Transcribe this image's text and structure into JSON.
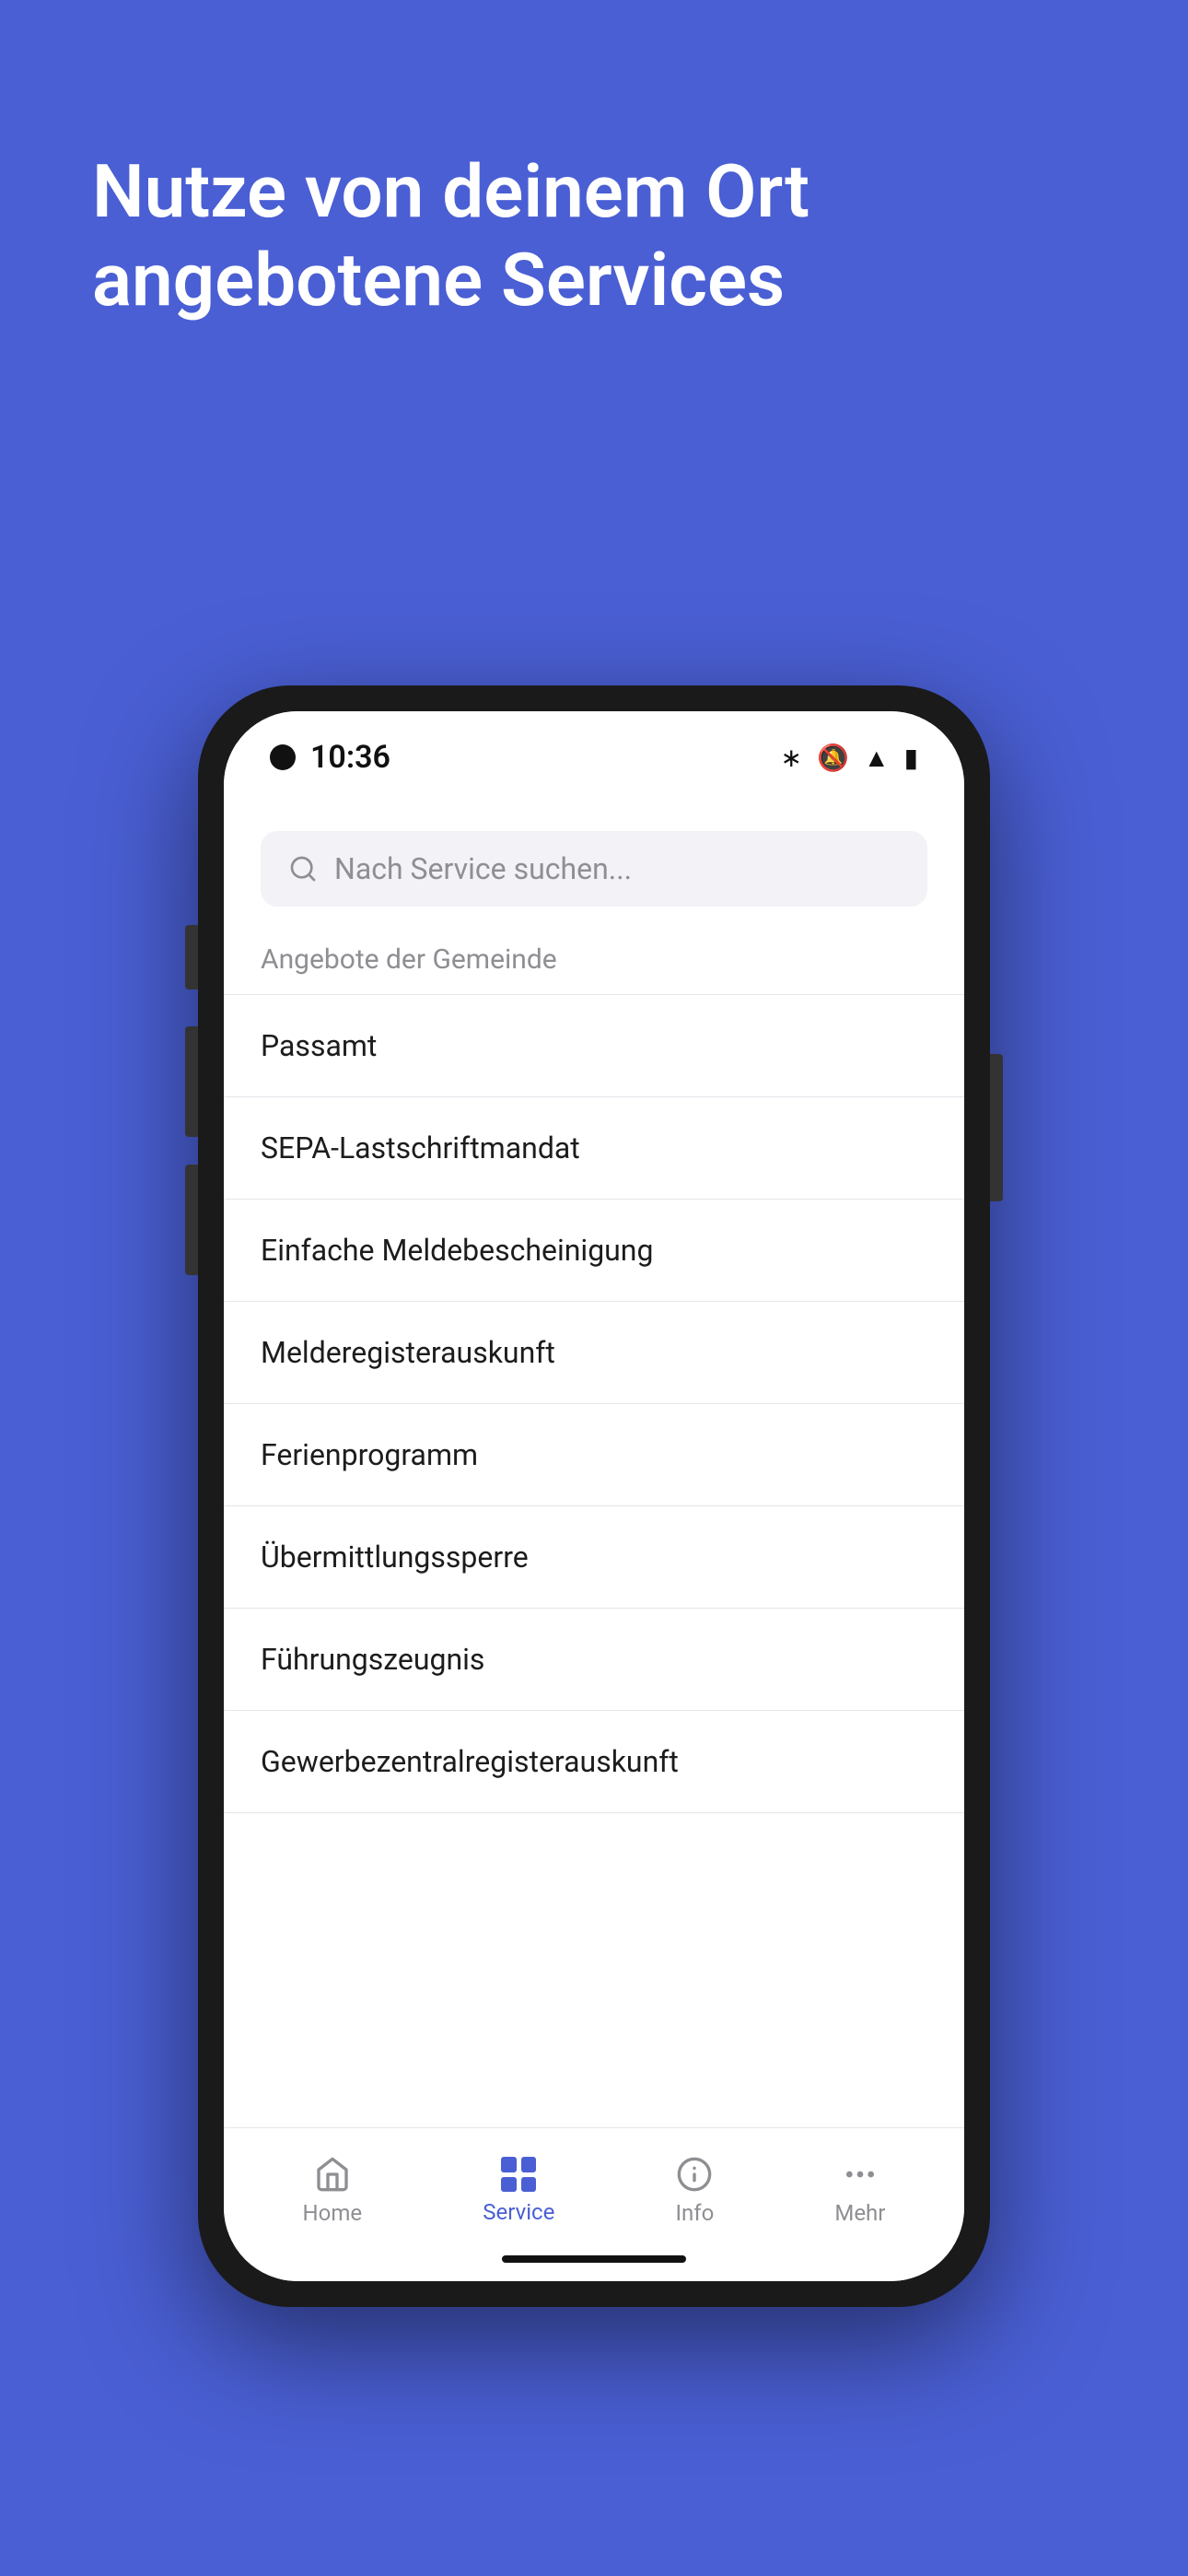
{
  "background_color": "#4A5FD4",
  "headline": {
    "line1": "Nutze von deinem Ort",
    "line2": "angebotene Services"
  },
  "phone": {
    "status_bar": {
      "time": "10:36"
    },
    "search": {
      "placeholder": "Nach Service suchen..."
    },
    "section_header": "Angebote der Gemeinde",
    "services": [
      {
        "label": "Passamt"
      },
      {
        "label": "SEPA-Lastschriftmandat"
      },
      {
        "label": "Einfache Meldebescheinigung"
      },
      {
        "label": "Melderegisterauskunft"
      },
      {
        "label": "Ferienprogramm"
      },
      {
        "label": "Übermittlungssperre"
      },
      {
        "label": "Führungszeugnis"
      },
      {
        "label": "Gewerbezentralregisterauskunft"
      }
    ],
    "bottom_nav": [
      {
        "label": "Home",
        "active": false,
        "icon": "home"
      },
      {
        "label": "Service",
        "active": true,
        "icon": "grid"
      },
      {
        "label": "Info",
        "active": false,
        "icon": "info"
      },
      {
        "label": "Mehr",
        "active": false,
        "icon": "more"
      }
    ]
  }
}
